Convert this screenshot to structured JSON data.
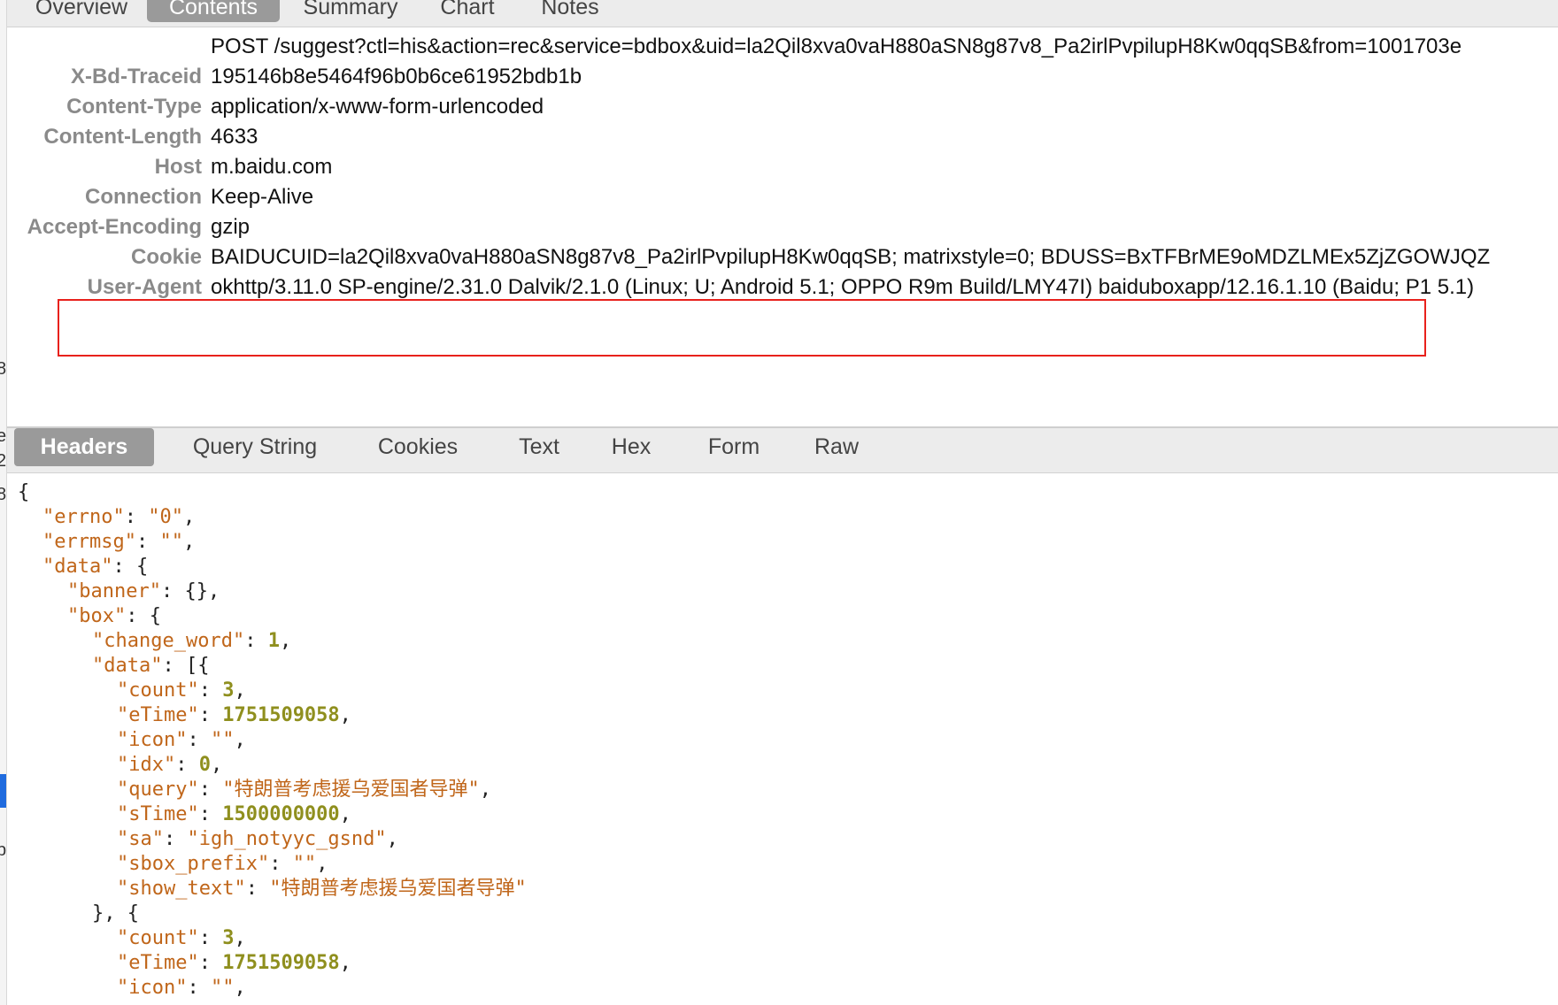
{
  "top_tabs": [
    {
      "label": "Overview"
    },
    {
      "label": "Contents",
      "active": true
    },
    {
      "label": "Summary"
    },
    {
      "label": "Chart"
    },
    {
      "label": "Notes"
    }
  ],
  "request": {
    "request_line": "POST /suggest?ctl=his&action=rec&service=bdbox&uid=la2Qil8xva0vaH880aSN8g87v8_Pa2irlPvpilupH8Kw0qqSB&from=1001703e",
    "headers": [
      {
        "key": "X-Bd-Traceid",
        "value": "195146b8e5464f96b0b6ce61952bdb1b"
      },
      {
        "key": "Content-Type",
        "value": "application/x-www-form-urlencoded"
      },
      {
        "key": "Content-Length",
        "value": "4633"
      },
      {
        "key": "Host",
        "value": "m.baidu.com"
      },
      {
        "key": "Connection",
        "value": "Keep-Alive"
      },
      {
        "key": "Accept-Encoding",
        "value": "gzip"
      },
      {
        "key": "Cookie",
        "value": "BAIDUCUID=la2Qil8xva0vaH880aSN8g87v8_Pa2irlPvpilupH8Kw0qqSB; matrixstyle=0; BDUSS=BxTFBrME9oMDZLMEx5ZjZGOWJQZ"
      },
      {
        "key": "User-Agent",
        "value": "okhttp/3.11.0 SP-engine/2.31.0 Dalvik/2.1.0 (Linux; U; Android 5.1; OPPO R9m Build/LMY47I) baiduboxapp/12.16.1.10 (Baidu; P1 5.1)",
        "highlighted": true
      }
    ]
  },
  "bottom_tabs": [
    {
      "label": "Headers",
      "active": true
    },
    {
      "label": "Query String"
    },
    {
      "label": "Cookies"
    },
    {
      "label": "Text"
    },
    {
      "label": "Hex"
    },
    {
      "label": "Form"
    },
    {
      "label": "Raw"
    }
  ],
  "gutter_glyphs": [
    "8",
    ":",
    "e",
    "2",
    "8",
    ":",
    "p"
  ],
  "json_lines": [
    {
      "indent": 0,
      "parts": [
        [
          "p",
          "{"
        ]
      ]
    },
    {
      "indent": 1,
      "parts": [
        [
          "k",
          "\"errno\""
        ],
        [
          "p",
          ": "
        ],
        [
          "s",
          "\"0\""
        ],
        [
          "p",
          ","
        ]
      ]
    },
    {
      "indent": 1,
      "parts": [
        [
          "k",
          "\"errmsg\""
        ],
        [
          "p",
          ": "
        ],
        [
          "s",
          "\"\""
        ],
        [
          "p",
          ","
        ]
      ]
    },
    {
      "indent": 1,
      "parts": [
        [
          "k",
          "\"data\""
        ],
        [
          "p",
          ": {"
        ]
      ]
    },
    {
      "indent": 2,
      "parts": [
        [
          "k",
          "\"banner\""
        ],
        [
          "p",
          ": {},"
        ]
      ]
    },
    {
      "indent": 2,
      "parts": [
        [
          "k",
          "\"box\""
        ],
        [
          "p",
          ": {"
        ]
      ]
    },
    {
      "indent": 3,
      "parts": [
        [
          "k",
          "\"change_word\""
        ],
        [
          "p",
          ": "
        ],
        [
          "n",
          "1"
        ],
        [
          "p",
          ","
        ]
      ]
    },
    {
      "indent": 3,
      "parts": [
        [
          "k",
          "\"data\""
        ],
        [
          "p",
          ": [{"
        ]
      ]
    },
    {
      "indent": 4,
      "parts": [
        [
          "k",
          "\"count\""
        ],
        [
          "p",
          ": "
        ],
        [
          "n",
          "3"
        ],
        [
          "p",
          ","
        ]
      ]
    },
    {
      "indent": 4,
      "parts": [
        [
          "k",
          "\"eTime\""
        ],
        [
          "p",
          ": "
        ],
        [
          "n",
          "1751509058"
        ],
        [
          "p",
          ","
        ]
      ]
    },
    {
      "indent": 4,
      "parts": [
        [
          "k",
          "\"icon\""
        ],
        [
          "p",
          ": "
        ],
        [
          "s",
          "\"\""
        ],
        [
          "p",
          ","
        ]
      ]
    },
    {
      "indent": 4,
      "parts": [
        [
          "k",
          "\"idx\""
        ],
        [
          "p",
          ": "
        ],
        [
          "n",
          "0"
        ],
        [
          "p",
          ","
        ]
      ]
    },
    {
      "indent": 4,
      "parts": [
        [
          "k",
          "\"query\""
        ],
        [
          "p",
          ": "
        ],
        [
          "s",
          "\"特朗普考虑援乌爱国者导弹\""
        ],
        [
          "p",
          ","
        ]
      ]
    },
    {
      "indent": 4,
      "parts": [
        [
          "k",
          "\"sTime\""
        ],
        [
          "p",
          ": "
        ],
        [
          "n",
          "1500000000"
        ],
        [
          "p",
          ","
        ]
      ]
    },
    {
      "indent": 4,
      "parts": [
        [
          "k",
          "\"sa\""
        ],
        [
          "p",
          ": "
        ],
        [
          "s",
          "\"igh_notyyc_gsnd\""
        ],
        [
          "p",
          ","
        ]
      ]
    },
    {
      "indent": 4,
      "parts": [
        [
          "k",
          "\"sbox_prefix\""
        ],
        [
          "p",
          ": "
        ],
        [
          "s",
          "\"\""
        ],
        [
          "p",
          ","
        ]
      ]
    },
    {
      "indent": 4,
      "parts": [
        [
          "k",
          "\"show_text\""
        ],
        [
          "p",
          ": "
        ],
        [
          "s",
          "\"特朗普考虑援乌爱国者导弹\""
        ]
      ]
    },
    {
      "indent": 3,
      "parts": [
        [
          "p",
          "}, {"
        ]
      ]
    },
    {
      "indent": 4,
      "parts": [
        [
          "k",
          "\"count\""
        ],
        [
          "p",
          ": "
        ],
        [
          "n",
          "3"
        ],
        [
          "p",
          ","
        ]
      ]
    },
    {
      "indent": 4,
      "parts": [
        [
          "k",
          "\"eTime\""
        ],
        [
          "p",
          ": "
        ],
        [
          "n",
          "1751509058"
        ],
        [
          "p",
          ","
        ]
      ]
    },
    {
      "indent": 4,
      "parts": [
        [
          "k",
          "\"icon\""
        ],
        [
          "p",
          ": "
        ],
        [
          "s",
          "\"\""
        ],
        [
          "p",
          ","
        ]
      ]
    }
  ],
  "colors": {
    "tab_active_bg": "#9a9a9a",
    "highlight_border": "#e8211c",
    "json_key": "#c0661a",
    "json_number": "#8f8f1e",
    "selection_blue": "#1f6bde"
  }
}
